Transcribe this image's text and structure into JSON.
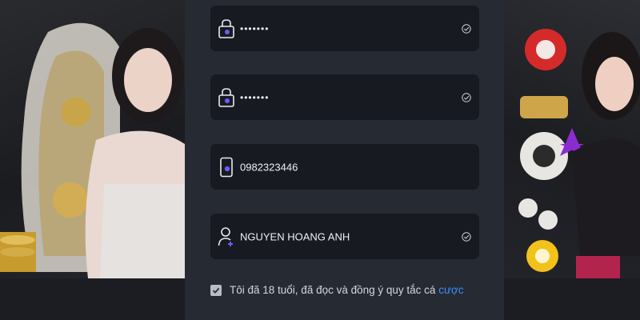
{
  "form": {
    "password": {
      "value": "•••••••",
      "icon": "lock-icon",
      "validated": true
    },
    "confirm_password": {
      "value": "•••••••",
      "icon": "lock-icon",
      "validated": true
    },
    "phone": {
      "value": "0982323446",
      "icon": "phone-icon"
    },
    "full_name": {
      "value": "NGUYEN HOANG ANH",
      "icon": "user-add-icon",
      "validated": true
    }
  },
  "agreement": {
    "checked": true,
    "text": "Tôi đã 18 tuổi, đã đọc và đồng ý quy tắc cá",
    "link_text": "cược"
  },
  "colors": {
    "panel_bg": "#262a33",
    "field_bg": "#171a21",
    "accent": "#3a8eff",
    "icon_accent": "#6c5bff"
  }
}
